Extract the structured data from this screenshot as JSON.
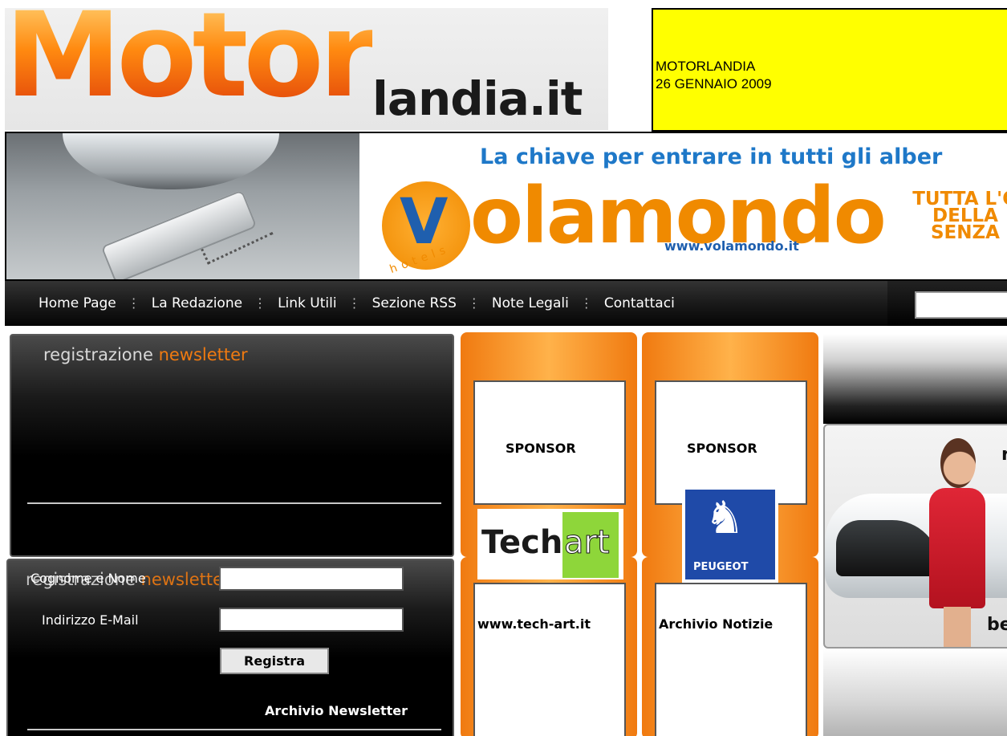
{
  "header": {
    "logo_text_big": "Motor",
    "logo_text_small": "landia.it",
    "date_box": {
      "line1": "MOTORLANDIA",
      "line2": "26 GENNAIO 2009"
    }
  },
  "banner": {
    "tagline": "La chiave per entrare in tutti gli alber",
    "brand": "olamondo",
    "brand_initial": "V",
    "hotels": "hotels",
    "url": "www.volamondo.it",
    "side_text": [
      "TUTTA L'O",
      "DELLA",
      "SENZA"
    ]
  },
  "nav": {
    "items": [
      "Home Page",
      "La Redazione",
      "Link Utili",
      "Sezione RSS",
      "Note Legali",
      "Contattaci"
    ],
    "separator": "⋮"
  },
  "newsletter": {
    "title_white": "registrazione",
    "title_orange": "newsletter",
    "field1_label": "Cognome e Nome",
    "field2_label": "Indirizzo E-Mail",
    "field1_value": "",
    "field2_value": "",
    "submit_label": "Registra",
    "archive_link": "Archivio Newsletter"
  },
  "sponsors": [
    {
      "label": "SPONSOR",
      "logo_a": "Tech",
      "logo_b": "art",
      "link": "www.tech-art.it"
    },
    {
      "label": "SPONSOR",
      "logo_a": "PEUGEOT",
      "link": "Archivio Notizie"
    }
  ],
  "right_ad": {
    "text_top": "r",
    "text_bottom": "be"
  },
  "colors": {
    "accent_orange": "#f07a10",
    "date_box_yellow": "#ffff00",
    "volamondo_blue": "#1e78c8"
  }
}
